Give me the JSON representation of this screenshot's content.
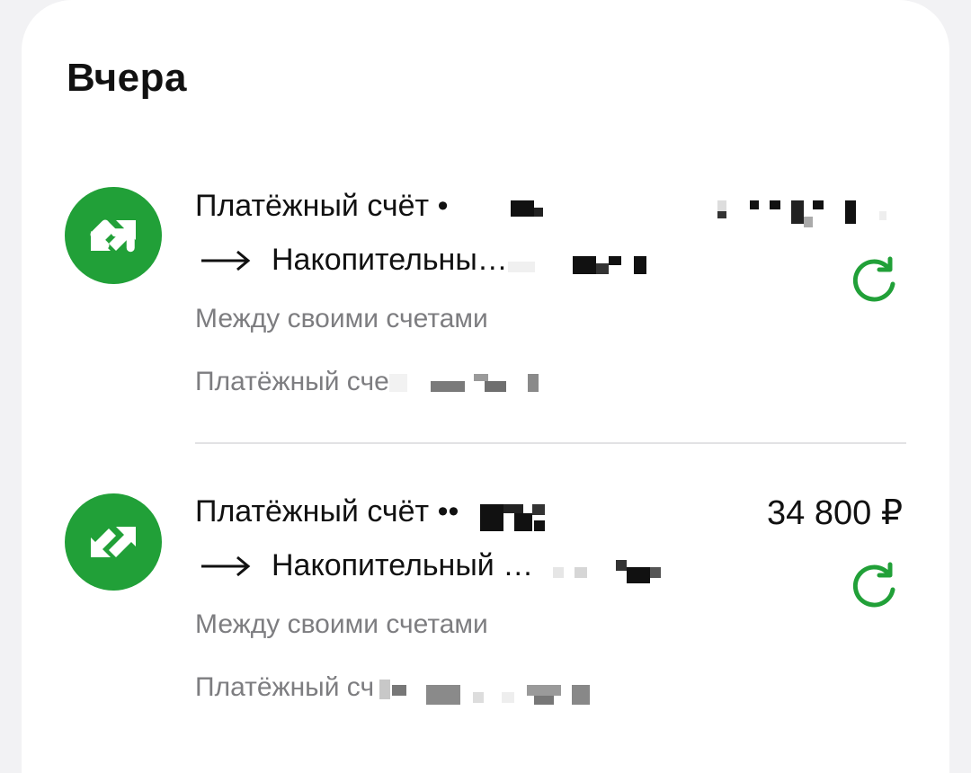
{
  "section": {
    "title": "Вчера"
  },
  "operations": [
    {
      "from": "Платёжный счёт •",
      "to": "Накопительны…",
      "category": "Между своими счетами",
      "subtitle": "Платёжный сче",
      "amount": "",
      "icon": "transfer-arrows-icon",
      "repeat_icon": "repeat-icon"
    },
    {
      "from": "Платёжный счёт ••",
      "to": "Накопительный …",
      "category": "Между своими счетами",
      "subtitle": "Платёжный сч",
      "amount": "34 800 ₽",
      "icon": "transfer-arrows-icon",
      "repeat_icon": "repeat-icon"
    }
  ],
  "colors": {
    "accent": "#21a038",
    "text": "#111111",
    "secondary_text": "#7d7d80",
    "background": "#ffffff",
    "divider": "#e2e2e4"
  }
}
